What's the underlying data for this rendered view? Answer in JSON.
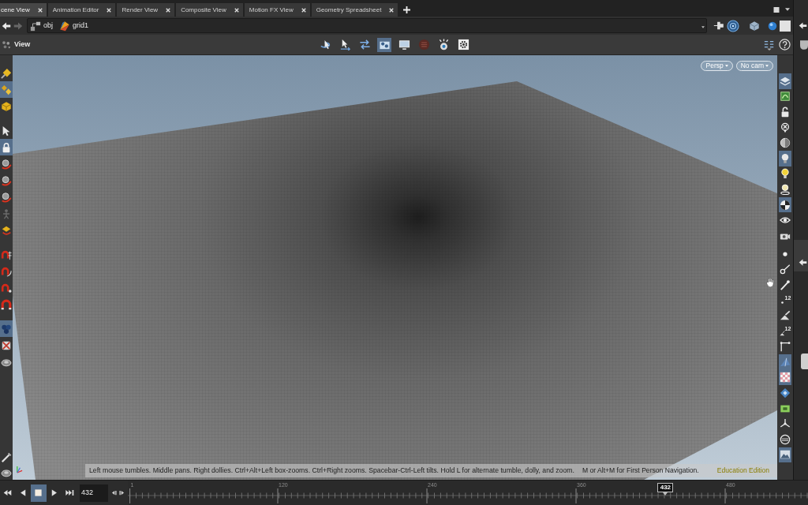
{
  "tabs": [
    {
      "label": "cene View",
      "selected": true
    },
    {
      "label": "Animation Editor",
      "selected": false
    },
    {
      "label": "Render View",
      "selected": false
    },
    {
      "label": "Composite View",
      "selected": false
    },
    {
      "label": "Motion FX View",
      "selected": false
    },
    {
      "label": "Geometry Spreadsheet",
      "selected": false
    }
  ],
  "path_bar": {
    "back": {
      "disabled": false
    },
    "forward": {
      "disabled": true
    },
    "nodes": [
      {
        "kind": "network",
        "label": "obj"
      },
      {
        "kind": "geometry",
        "label": "grid1"
      }
    ]
  },
  "viewer": {
    "title": "View",
    "tools": [
      {
        "kind": "tumble",
        "selected": false
      },
      {
        "kind": "select-arrows",
        "selected": false
      },
      {
        "kind": "swap",
        "selected": false
      },
      {
        "kind": "film-camera",
        "selected": true
      },
      {
        "kind": "monitor",
        "selected": false
      },
      {
        "kind": "record",
        "selected": false
      },
      {
        "kind": "snapshot",
        "selected": false
      },
      {
        "kind": "gear",
        "selected": false
      }
    ],
    "camera_menus": [
      {
        "label": "Persp"
      },
      {
        "label": "No cam"
      }
    ],
    "hint": "Left mouse tumbles. Middle pans. Right dollies. Ctrl+Alt+Left box-zooms. Ctrl+Right zooms. Spacebar-Ctrl-Left tilts. Hold L for alternate tumble, dolly, and zoom.",
    "navigation_hint": "M or Alt+M for First Person Navigation.",
    "edition": "Education Edition"
  },
  "left_toolbar": {
    "groups": [
      {
        "tools": [
          {
            "kind": "brush",
            "selected": false
          },
          {
            "kind": "brush-pair",
            "selected": true
          },
          {
            "kind": "box",
            "selected": false
          }
        ]
      },
      {
        "tools": [
          {
            "kind": "pointer",
            "selected": false
          },
          {
            "kind": "lock",
            "selected": true
          },
          {
            "kind": "orbit",
            "selected": false
          },
          {
            "kind": "orbit",
            "selected": false
          },
          {
            "kind": "orbit",
            "selected": false
          },
          {
            "kind": "figure",
            "selected": false
          },
          {
            "kind": "paint",
            "selected": false
          }
        ]
      },
      {
        "tools": [
          {
            "kind": "magnet-grid",
            "selected": false
          },
          {
            "kind": "magnet-curve",
            "selected": false
          },
          {
            "kind": "magnet-dots",
            "selected": false
          },
          {
            "kind": "magnet",
            "selected": false
          }
        ]
      },
      {
        "tools": [
          {
            "kind": "spheres",
            "selected": true
          },
          {
            "kind": "crossed-box",
            "selected": false
          },
          {
            "kind": "disc",
            "selected": false
          }
        ]
      },
      {
        "tools": [
          {
            "kind": "wand",
            "selected": false
          },
          {
            "kind": "disc",
            "selected": false
          }
        ]
      }
    ]
  },
  "right_toolbar": {
    "groups": [
      {
        "tools": [
          {
            "kind": "layers",
            "selected": true
          },
          {
            "kind": "uv",
            "selected": false
          },
          {
            "kind": "open-lock",
            "selected": false
          },
          {
            "kind": "cross-pin",
            "selected": false
          },
          {
            "kind": "half-sphere",
            "selected": false
          },
          {
            "kind": "bulb",
            "selected": true
          },
          {
            "kind": "bulb-lit",
            "selected": false
          },
          {
            "kind": "bulb-pin",
            "selected": false
          },
          {
            "kind": "checker-ball",
            "selected": true
          },
          {
            "kind": "eye",
            "selected": false
          },
          {
            "kind": "camera",
            "selected": false
          }
        ]
      },
      {
        "tools": [
          {
            "kind": "dot",
            "selected": false
          },
          {
            "kind": "point-line",
            "selected": false
          },
          {
            "kind": "pen",
            "selected": false
          },
          {
            "kind": "dot",
            "selected": false,
            "badge": "12"
          },
          {
            "kind": "brush-fill",
            "selected": false
          },
          {
            "kind": "brush-fill",
            "selected": false,
            "badge": "12"
          },
          {
            "kind": "corner",
            "selected": false
          },
          {
            "kind": "wedge",
            "selected": true
          },
          {
            "kind": "checker",
            "selected": true
          },
          {
            "kind": "diamond",
            "selected": false
          },
          {
            "kind": "frame",
            "selected": false
          },
          {
            "kind": "axes",
            "selected": false
          },
          {
            "kind": "ring",
            "selected": false
          },
          {
            "kind": "picture",
            "selected": true
          }
        ]
      }
    ]
  },
  "playbar": {
    "buttons": [
      {
        "kind": "first",
        "selected": false
      },
      {
        "kind": "reverse",
        "selected": false
      },
      {
        "kind": "stop",
        "selected": true
      },
      {
        "kind": "play",
        "selected": false
      },
      {
        "kind": "last",
        "selected": false
      }
    ],
    "frame": "432",
    "ruler_labels": [
      "1",
      "120",
      "240",
      "360",
      "480"
    ],
    "current_frame": "432"
  }
}
